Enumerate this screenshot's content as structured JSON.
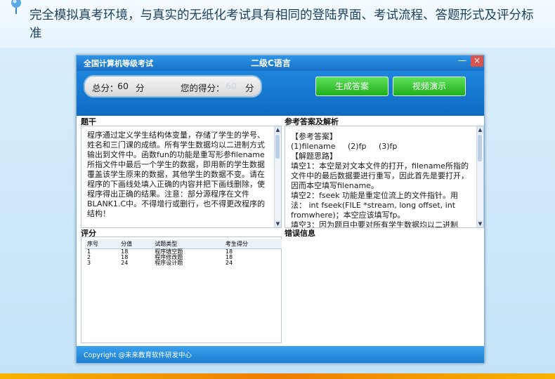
{
  "banner": {
    "description": "完全模拟真考环境，与真实的无纸化考试具有相同的登陆界面、考试流程、答题形式及评分标准"
  },
  "window": {
    "app_title": "全国计算机等级考试",
    "exam_title": "二级C语言",
    "minimize_glyph": "—",
    "close_glyph": "×"
  },
  "score": {
    "total_label": "总分：",
    "total_value": "60",
    "total_unit": "分",
    "got_label": "您的得分：",
    "got_value": "60",
    "got_unit": "分"
  },
  "buttons": {
    "generate": "生成答案",
    "video": "视频演示"
  },
  "sections": {
    "question": "题干",
    "reference": "参考答案及解析",
    "grading": "评分",
    "errors": "错误信息"
  },
  "question_text": "程序通过定义学生结构体变量，存储了学生的学号、姓名和三门课的成绩。所有学生数据均以二进制方式输出到文件中。函数fun的功能是重写形参filename所指文件中最后一个学生的数据，即用新的学生数据覆盖该学生原来的数据，其他学生的数据不变。请在程序的下画线处填入正确的内容并把下画线删除，使程序得出正确的结果。注意：部分源程序在文件BLANK1.C中。不得增行或删行，也不得更改程序的结构！",
  "reference": {
    "answer_heading": "【参考答案】",
    "answers": [
      "(1)filename",
      "(2)fp",
      "(3)fp"
    ],
    "idea_heading": "【解题思路】",
    "idea_1": "填空1：本空是对文本文件的打开，filename所指的文件中的最后数据要进行重写，因此首先是要打开，因而本空填写filename。",
    "idea_2": "填空2：fseek 功能是重定位流上的文件指针。用法： int fseek(FILE *stream, long offset, int fromwhere)；本空应该填写fp。",
    "idea_3": "填空3：因为题目中要对所有学生数据均以二进制"
  },
  "grading_table": {
    "headers": [
      "序号",
      "分值",
      "试题类型",
      "考生得分"
    ],
    "rows": [
      [
        "1",
        "18",
        "程序填空题",
        "18"
      ],
      [
        "2",
        "18",
        "程序修改题",
        "18"
      ],
      [
        "3",
        "24",
        "程序设计题",
        "24"
      ]
    ]
  },
  "footer": {
    "copyright": "Copyright @未来教育软件研发中心"
  },
  "colors": {
    "titlebar": "#1770c6",
    "button_green": "#1fae1a",
    "bottom_strip": "#f07c00"
  },
  "icons": {
    "banner_pin": "pin-icon",
    "scroll_up": "chevron-up-icon",
    "scroll_down": "chevron-down-icon"
  }
}
